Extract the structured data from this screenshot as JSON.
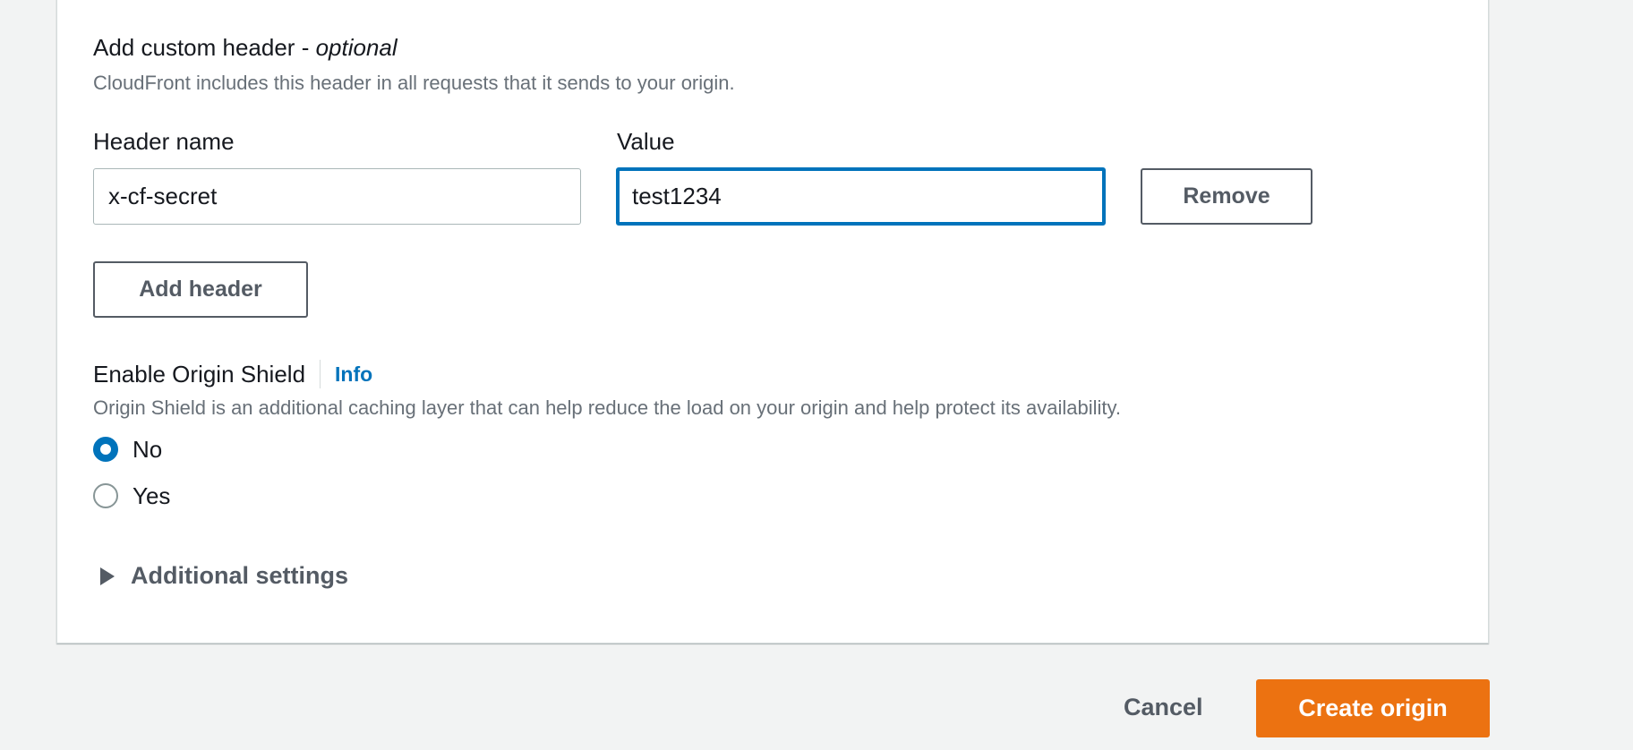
{
  "custom_header": {
    "title": "Add custom header - ",
    "title_optional": "optional",
    "description": "CloudFront includes this header in all requests that it sends to your origin.",
    "header_name_label": "Header name",
    "header_name_value": "x-cf-secret",
    "value_label": "Value",
    "value_value": "test1234",
    "remove_label": "Remove",
    "add_header_label": "Add header"
  },
  "origin_shield": {
    "title": "Enable Origin Shield",
    "info_label": "Info",
    "description": "Origin Shield is an additional caching layer that can help reduce the load on your origin and help protect its availability.",
    "options": [
      {
        "label": "No",
        "checked": true
      },
      {
        "label": "Yes",
        "checked": false
      }
    ]
  },
  "additional_settings": {
    "label": "Additional settings"
  },
  "footer": {
    "cancel_label": "Cancel",
    "create_label": "Create origin"
  },
  "colors": {
    "accent": "#0073bb",
    "primary_button": "#ec7211",
    "text_secondary": "#687078"
  }
}
